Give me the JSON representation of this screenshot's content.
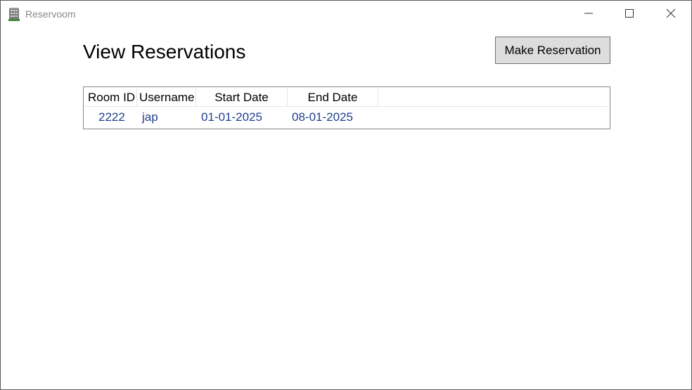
{
  "window": {
    "title": "Reservoom",
    "icon": "building-icon"
  },
  "header": {
    "title": "View Reservations",
    "make_reservation_label": "Make Reservation"
  },
  "reservations": {
    "columns": [
      "Room ID",
      "Username",
      "Start Date",
      "End Date"
    ],
    "rows": [
      {
        "room_id": "2222",
        "username": "jap",
        "start_date": "01-01-2025",
        "end_date": "08-01-2025"
      }
    ]
  },
  "colors": {
    "cell_text": "#1f3f8f",
    "button_bg": "#dddddd",
    "title_text": "#8a8a8a"
  }
}
